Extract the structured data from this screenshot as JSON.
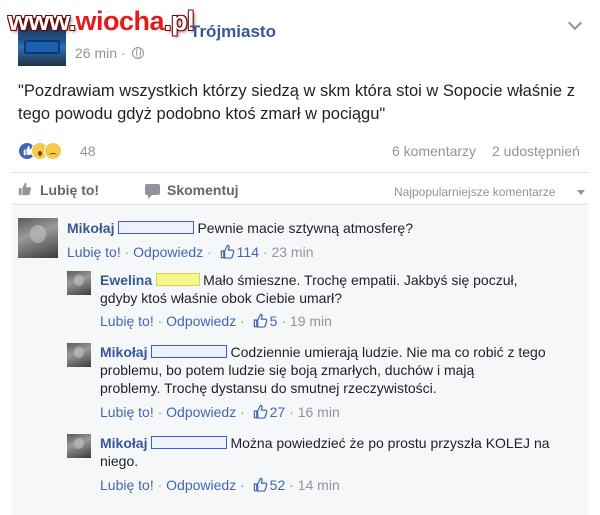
{
  "header": {
    "watermark": {
      "part1": "www.",
      "part2": "wiocha",
      "part3": ".pl"
    },
    "page_name": "Trójmiasto",
    "time": "26 min ·"
  },
  "post": {
    "text": "\"Pozdrawiam wszystkich którzy siedzą w skm która stoi w Sopocie właśnie z tego powodu gdyż podobno ktoś zmarł w pociągu\"",
    "reaction_count": "48",
    "comment_count": "6 komentarzy",
    "share_count": "2 udostępnień"
  },
  "actions": {
    "like": "Lubię to!",
    "comment": "Skomentuj",
    "sort": "Najpopularniejsze komentarze"
  },
  "comments": [
    {
      "author": "Mikołaj",
      "text": "Pewnie macie sztywną atmosferę?",
      "like": "Lubię to!",
      "reply": "Odpowiedz",
      "likes": "114",
      "time": "23 min",
      "box_color": "#3b5bdb"
    },
    {
      "author": "Ewelina",
      "text1": "Mało śmieszne. Trochę empatii. Jakbyś się poczuł,",
      "text2": "gdyby ktoś właśnie obok Ciebie umarł?",
      "like": "Lubię to!",
      "reply": "Odpowiedz",
      "likes": "5",
      "time": "19 min",
      "box_color": "#f6f78a"
    },
    {
      "author": "Mikołaj",
      "text1": "Codziennie umierają ludzie. Nie ma co robić z tego",
      "text2": "problemu, bo potem ludzie się boją zmarłych, duchów i mają",
      "text3": "problemy. Trochę dystansu do smutnej rzeczywistości.",
      "like": "Lubię to!",
      "reply": "Odpowiedz",
      "likes": "27",
      "time": "16 min",
      "box_color": "#3b5bdb"
    },
    {
      "author": "Mikołaj",
      "text1": "Można powiedzieć że po prostu przyszła KOLEJ na",
      "text2": "niego.",
      "like": "Lubię to!",
      "reply": "Odpowiedz",
      "likes": "52",
      "time": "14 min",
      "box_color": "#3b5bdb"
    }
  ],
  "colors": {
    "link": "#365899",
    "muted": "#90949c",
    "reaction_like": "#4267b2",
    "reaction_yellow": "#f7c948"
  }
}
